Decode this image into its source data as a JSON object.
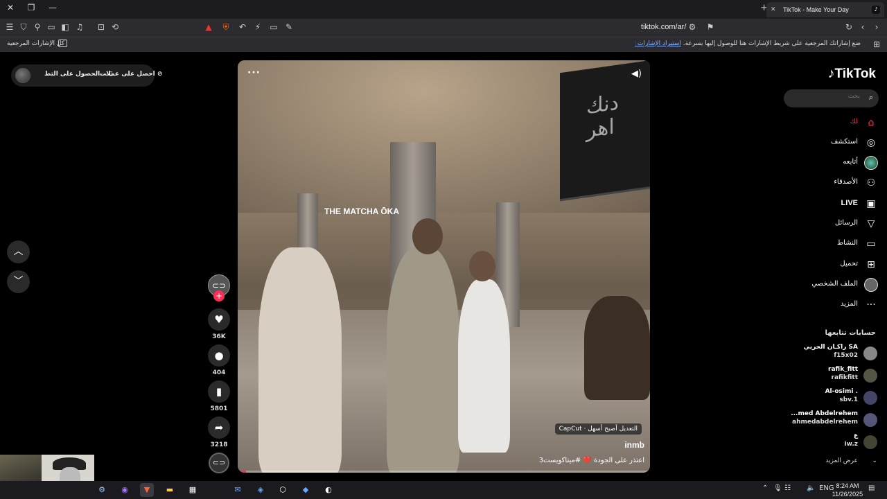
{
  "browser": {
    "tab_title": "TikTok - Make Your Day",
    "url": "tiktok.com/ar/",
    "bookmarks_all": "كل الإشارات المرجعية",
    "bookmarks_message": "ضع إشاراتك المرجعية على شريط الإشارات هنا للوصول إليها بسرعة.",
    "bookmarks_import_link": "استيراد الإشارات المرجعية الآن..."
  },
  "promo": {
    "get_coins": "احصل على عملات",
    "get_app": "الحصول على التط..."
  },
  "video": {
    "sign_text": "دنك\nاهر",
    "store_sign": "THE MATCHA ŌKA",
    "more_label": "···",
    "capcut_label": "CapCut · التعديل أصبح أسهل",
    "author": "inmb",
    "description": "اعتذر على الجودة ❤️ #ميتاكويست3",
    "progress": 0.02
  },
  "actions": {
    "likes": "36K",
    "comments": "404",
    "saves": "5801",
    "shares": "3218"
  },
  "sidebar": {
    "logo": "TikTok",
    "search_placeholder": "بحث",
    "nav": [
      {
        "label": "لك",
        "icon": "home-icon"
      },
      {
        "label": "استكشف",
        "icon": "compass-icon"
      },
      {
        "label": "أتابعه",
        "icon": "avatar-icon"
      },
      {
        "label": "الأصدقاء",
        "icon": "friends-icon"
      },
      {
        "label": "LIVE",
        "icon": "live-icon"
      },
      {
        "label": "الرسائل",
        "icon": "send-icon"
      },
      {
        "label": "النشاط",
        "icon": "activity-icon"
      },
      {
        "label": "تحميل",
        "icon": "upload-icon"
      },
      {
        "label": "الملف الشخصي",
        "icon": "profile-icon"
      },
      {
        "label": "المزيد",
        "icon": "more-icon"
      }
    ],
    "following_header": "حسابات تتابعها",
    "accounts": [
      {
        "name": "راكـان الحربي SA",
        "username": "f15x02"
      },
      {
        "name": "rafik_fitt",
        "username": "rafikfitt"
      },
      {
        "name": "Al-osimi .",
        "username": "sbv.1"
      },
      {
        "name": "...med Abdelrehem",
        "username": "ahmedabdelrehem"
      },
      {
        "name": "ع",
        "username": "iw.z"
      }
    ],
    "show_more": "عرض المزيد"
  },
  "taskbar": {
    "lang": "ENG",
    "time": "8:24 AM",
    "date": "11/26/2025"
  },
  "colors": {
    "accent": "#fe2c55",
    "background": "#000000"
  }
}
